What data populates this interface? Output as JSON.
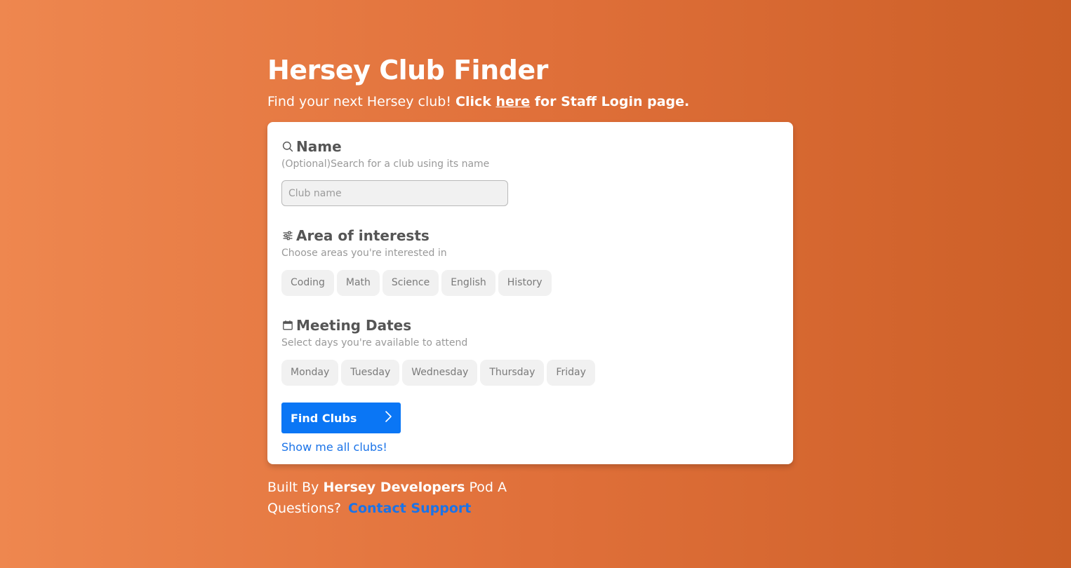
{
  "header": {
    "title": "Hersey Club Finder",
    "subtitle_text": "Find your next Hersey club! ",
    "subtitle_click": "Click ",
    "subtitle_link": "here",
    "subtitle_tail": " for Staff Login page."
  },
  "form": {
    "name_section": {
      "icon": "search-icon",
      "title": "Name",
      "description": "(Optional)Search for a club using its name",
      "placeholder": "Club name",
      "value": ""
    },
    "interests_section": {
      "icon": "sliders-icon",
      "title": "Area of interests",
      "description": "Choose areas you're interested in",
      "options": [
        "Coding",
        "Math",
        "Science",
        "English",
        "History"
      ]
    },
    "dates_section": {
      "icon": "calendar-icon",
      "title": "Meeting Dates",
      "description": "Select days you're available to attend",
      "options": [
        "Monday",
        "Tuesday",
        "Wednesday",
        "Thursday",
        "Friday"
      ]
    },
    "find_button_label": "Find Clubs",
    "find_button_icon": "chevron-right-icon",
    "show_all_label": "Show me all clubs!"
  },
  "footer": {
    "built_by_prefix": "Built By ",
    "built_by_team": "Hersey Developers",
    "built_by_suffix": " Pod A",
    "questions_label": "Questions? ",
    "contact_label": "Contact Support"
  },
  "colors": {
    "accent": "#0a76f5",
    "link": "#1a73e8",
    "background_start": "#ee874f",
    "background_end": "#cc5f27"
  }
}
